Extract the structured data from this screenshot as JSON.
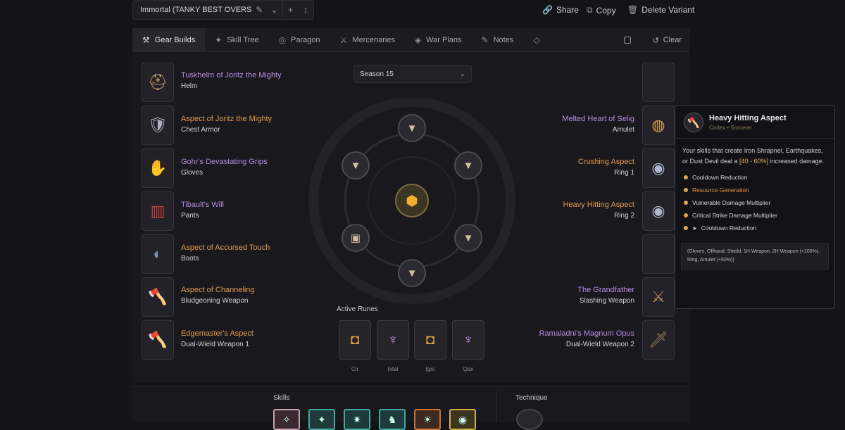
{
  "topbar": {
    "variant_name": "Immortal (TANKY BEST OVERS",
    "share_label": "Share",
    "copy_label": "Copy",
    "delete_label": "Delete Variant"
  },
  "tabs": [
    {
      "label": "Gear Builds",
      "icon": "gear-builds-icon",
      "active": true
    },
    {
      "label": "Skill Tree",
      "icon": "skill-tree-icon"
    },
    {
      "label": "Paragon",
      "icon": "paragon-icon"
    },
    {
      "label": "Mercenaries",
      "icon": "mercenaries-icon"
    },
    {
      "label": "War Plans",
      "icon": "war-plans-icon"
    },
    {
      "label": "Notes",
      "icon": "notes-icon"
    }
  ],
  "clear_label": "Clear",
  "season": {
    "value": "Season 15"
  },
  "left_items": [
    {
      "name": "Tuskhelm of Joritz the Mighty",
      "type": "Helm",
      "rarity": "unique"
    },
    {
      "name": "Aspect of Joritz the Mighty",
      "type": "Chest Armor",
      "rarity": "legendary"
    },
    {
      "name": "Gohr's Devastating Grips",
      "type": "Gloves",
      "rarity": "unique"
    },
    {
      "name": "Tibault's Will",
      "type": "Pants",
      "rarity": "unique"
    },
    {
      "name": "Aspect of Accursed Touch",
      "type": "Boots",
      "rarity": "legendary"
    },
    {
      "name": "Aspect of Channeling",
      "type": "Bludgeoning Weapon",
      "rarity": "legendary"
    },
    {
      "name": "Edgemaster's Aspect",
      "type": "Dual-Wield Weapon 1",
      "rarity": "legendary"
    }
  ],
  "right_items": [
    {
      "name": "",
      "type": ""
    },
    {
      "name": "Melted Heart of Selig",
      "type": "Amulet",
      "rarity": "unique"
    },
    {
      "name": "Crushing Aspect",
      "type": "Ring 1",
      "rarity": "legendary"
    },
    {
      "name": "Heavy Hitting Aspect",
      "type": "Ring 2",
      "rarity": "legendary"
    },
    {
      "name": "",
      "type": ""
    },
    {
      "name": "The Grandfather",
      "type": "Slashing Weapon",
      "rarity": "unique"
    },
    {
      "name": "Ramaladni's Magnum Opus",
      "type": "Dual-Wield Weapon 2",
      "rarity": "unique"
    }
  ],
  "active_runes": {
    "label": "Active Runes",
    "runes": [
      {
        "caption": "Cir"
      },
      {
        "caption": "Ixtal"
      },
      {
        "caption": "Igni"
      },
      {
        "caption": "Qax"
      }
    ]
  },
  "tooltip": {
    "title": "Heavy Hitting Aspect",
    "subtitle": "Codex • Sorcerer",
    "desc_pre": "Your skills that create Iron Shrapnel, Earthquakes, or Dust Devil deal a ",
    "desc_highlight": "[40 - 60%]",
    "desc_post": " increased damage.",
    "affixes": [
      {
        "label": "Cooldown Reduction"
      },
      {
        "label": "Resource Generation",
        "greater": true
      },
      {
        "label": "Vulnerable Damage Multiplier"
      },
      {
        "label": "Critical Strike Damage Multiplier"
      },
      {
        "label": "Cooldown Reduction",
        "tempered": true
      }
    ],
    "footer": "(Gloves, Offhand, Shield, 1H Weapon, 2H Weapon (+100%), Ring, Amulet (+50%))"
  },
  "skills_label": "Skills",
  "technique_label": "Technique",
  "colors": {
    "legendary": "#e19a4b",
    "unique": "#b48be0",
    "accent_teal": "#3ca8a0"
  }
}
